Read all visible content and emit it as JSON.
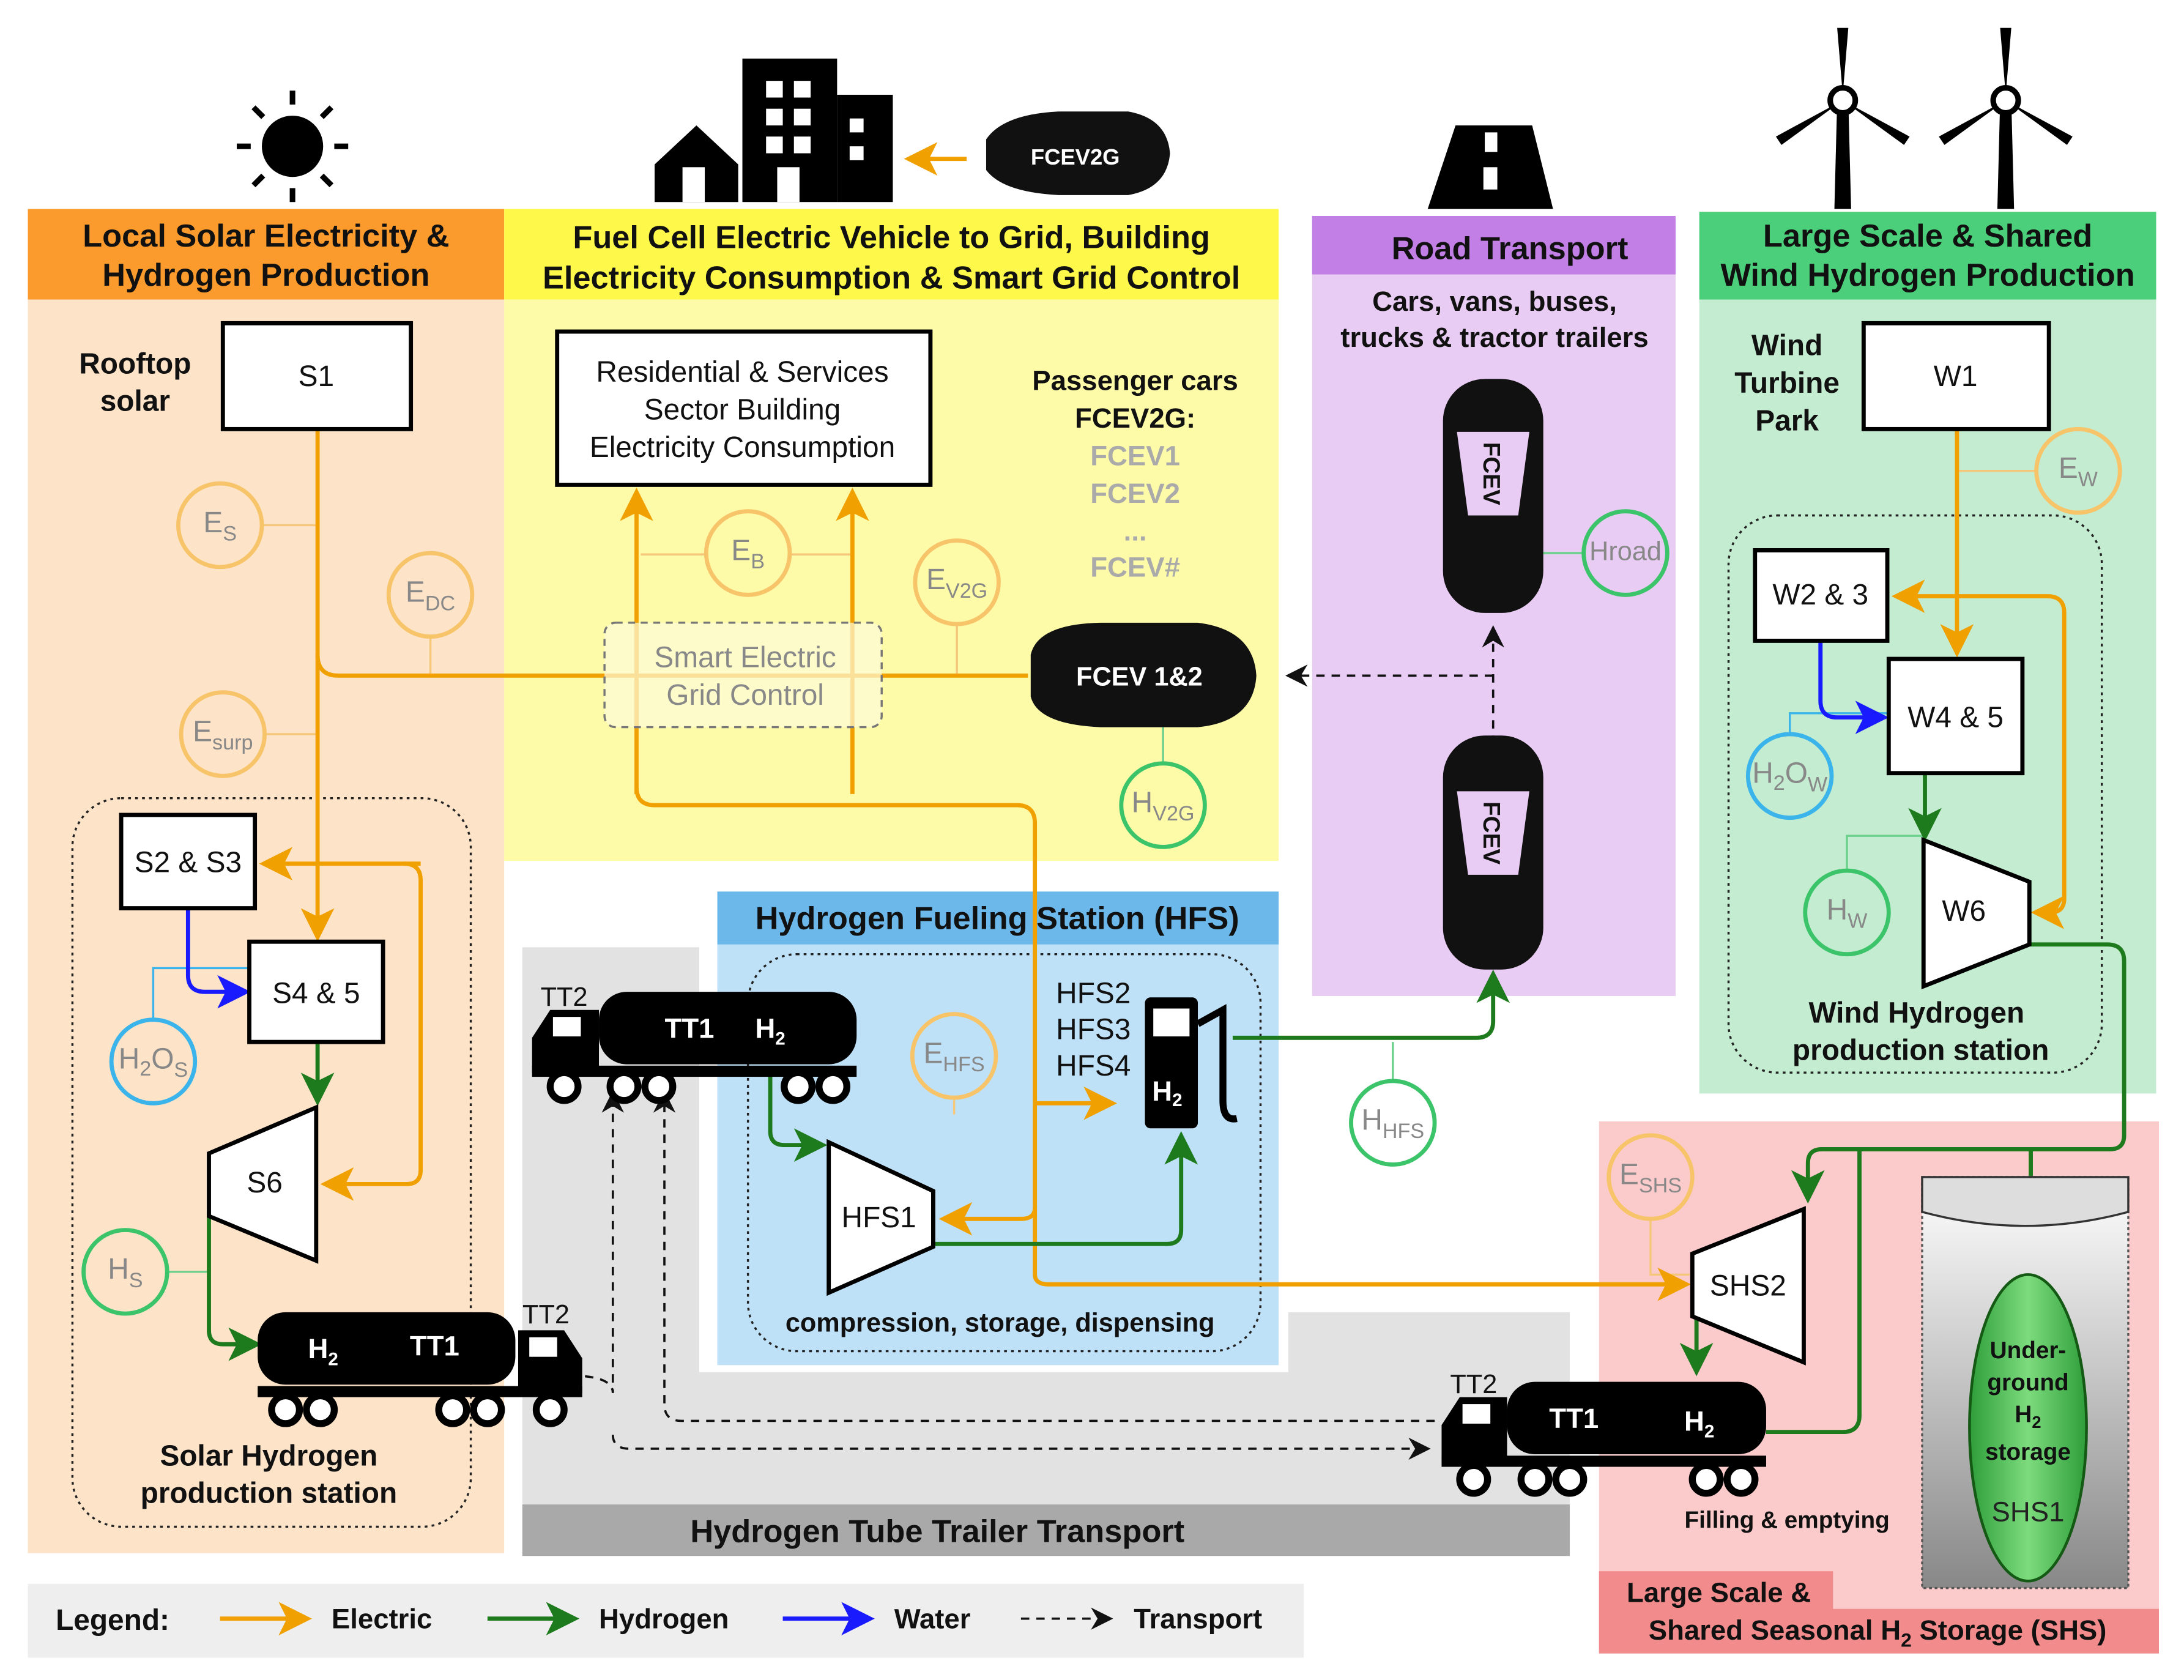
{
  "colors": {
    "electric": "#f0a000",
    "hydrogen": "#1d7a1d",
    "water": "#1a1aff",
    "transport": "#111111",
    "solar": "#fb9a2d",
    "v2g": "#fdf84a",
    "road": "#c27fe6",
    "wind": "#4ccf7a",
    "hfs": "#6db8ea",
    "tube": "#a8a8a8",
    "shs": "#f28b8b"
  },
  "icons": [
    "sun-icon",
    "buildings-icon",
    "road-icon",
    "wind-turbine-icon",
    "car-icon",
    "truck-icon",
    "fuel-pump-icon"
  ],
  "solar": {
    "title1": "Local Solar Electricity &",
    "title2": "Hydrogen Production",
    "rooftop1": "Rooftop",
    "rooftop2": "solar",
    "station1": "Solar Hydrogen",
    "station2": "production station"
  },
  "v2g": {
    "title1": "Fuel Cell Electric Vehicle to Grid, Building",
    "title2": "Electricity Consumption & Smart Grid Control",
    "building1": "Residential & Services",
    "building2": "Sector Building",
    "building3": "Electricity Consumption",
    "smart1": "Smart Electric",
    "smart2": "Grid Control",
    "pass1": "Passenger cars",
    "pass2": "FCEV2G:",
    "fcev_list": [
      "FCEV1",
      "FCEV2",
      "...",
      "FCEV#"
    ],
    "car_top": "FCEV",
    "car_top_sub": "2G",
    "car_main": "FCEV",
    "car_main_sub": "1&2"
  },
  "road": {
    "title": "Road Transport",
    "sub1": "Cars, vans, buses,",
    "sub2": "trucks & tractor trailers",
    "car_label": "FCEV"
  },
  "wind": {
    "title1": "Large Scale & Shared",
    "title2": "Wind Hydrogen Production",
    "park1": "Wind",
    "park2": "Turbine",
    "park3": "Park",
    "station1": "Wind Hydrogen",
    "station2": "production station"
  },
  "hfs": {
    "title": "Hydrogen Fueling  Station (HFS)",
    "units": [
      "HFS2",
      "HFS3",
      "HFS4"
    ],
    "caption": "compression, storage, dispensing",
    "pump_label": "H",
    "pump_sub": "2"
  },
  "tube": {
    "title": "Hydrogen Tube Trailer Transport",
    "tt1": "TT1",
    "tt2": "TT2",
    "h": "H",
    "h_sub": "2"
  },
  "shs": {
    "title1": "Large Scale &",
    "title2a": "Shared Seasonal H",
    "title2sub": "2",
    "title2b": " Storage (SHS)",
    "filling": "Filling & emptying",
    "storage": [
      "Under-",
      "ground",
      "H",
      "storage"
    ],
    "storage_sub": "2",
    "shs1": "SHS1"
  },
  "nodes": {
    "S1": "S1",
    "S23": "S2 & S3",
    "S45": "S4 & 5",
    "S6": "S6",
    "W1": "W1",
    "W23": "W2 & 3",
    "W45": "W4 & 5",
    "W6": "W6",
    "HFS1": "HFS1",
    "SHS2": "SHS2"
  },
  "vars": {
    "Es": {
      "b": "E",
      "s": "S"
    },
    "Edc": {
      "b": "E",
      "s": "DC"
    },
    "Esurp": {
      "b": "E",
      "s": "surp"
    },
    "Eb": {
      "b": "E",
      "s": "B"
    },
    "Ev2g": {
      "b": "E",
      "s": "V2G"
    },
    "Hv2g": {
      "b": "H",
      "s": "V2G"
    },
    "Hroad": {
      "b": "Hroad",
      "s": ""
    },
    "Ew": {
      "b": "E",
      "s": "W"
    },
    "H2Ow": {
      "b": "H",
      "m": "2",
      "o": "O",
      "s": "W"
    },
    "Hw": {
      "b": "H",
      "s": "W"
    },
    "H2Os": {
      "b": "H",
      "m": "2",
      "o": "O",
      "s": "S"
    },
    "Hs": {
      "b": "H",
      "s": "S"
    },
    "Ehfs": {
      "b": "E",
      "s": "HFS"
    },
    "Hhfs": {
      "b": "H",
      "s": "HFS"
    },
    "Eshs": {
      "b": "E",
      "s": "SHS"
    }
  },
  "legend": {
    "title": "Legend:",
    "electric": "Electric",
    "hydrogen": "Hydrogen",
    "water": "Water",
    "transport": "Transport"
  }
}
